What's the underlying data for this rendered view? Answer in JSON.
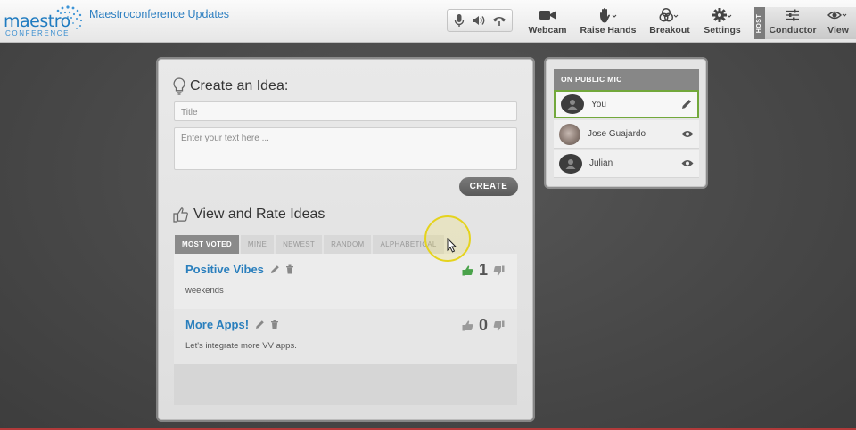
{
  "topbar": {
    "logo_word": "maestro",
    "logo_sub": "CONFERENCE",
    "conference_title": "Maestroconference Updates",
    "buttons": {
      "webcam": "Webcam",
      "raise_hands": "Raise Hands",
      "breakout": "Breakout",
      "settings": "Settings",
      "host_badge": "HOST",
      "conductor": "Conductor",
      "view": "View"
    }
  },
  "create_idea": {
    "heading": "Create an Idea:",
    "title_placeholder": "Title",
    "text_placeholder": "Enter your text here ...",
    "create_button": "CREATE"
  },
  "view_ideas": {
    "heading": "View and Rate Ideas",
    "tabs": [
      {
        "label": "MOST VOTED",
        "active": true
      },
      {
        "label": "MINE",
        "active": false
      },
      {
        "label": "NEWEST",
        "active": false
      },
      {
        "label": "RANDOM",
        "active": false
      },
      {
        "label": "ALPHABETICAL",
        "active": false
      }
    ],
    "ideas": [
      {
        "title": "Positive Vibes",
        "description": "weekends",
        "votes": "1",
        "upvoted": true
      },
      {
        "title": "More Apps!",
        "description": "Let's integrate more VV apps.",
        "votes": "0",
        "upvoted": false
      }
    ]
  },
  "public_mic": {
    "header": "ON PUBLIC MIC",
    "participants": [
      {
        "name": "You",
        "action_icon": "pencil-icon"
      },
      {
        "name": "Jose Guajardo",
        "action_icon": "eye-icon"
      },
      {
        "name": "Julian",
        "action_icon": "eye-icon"
      }
    ]
  },
  "colors": {
    "brand_blue": "#2a7fbd",
    "upvote_green": "#4aa24a",
    "highlight_green": "#72a83b",
    "cursor_highlight": "#e5d31d"
  }
}
